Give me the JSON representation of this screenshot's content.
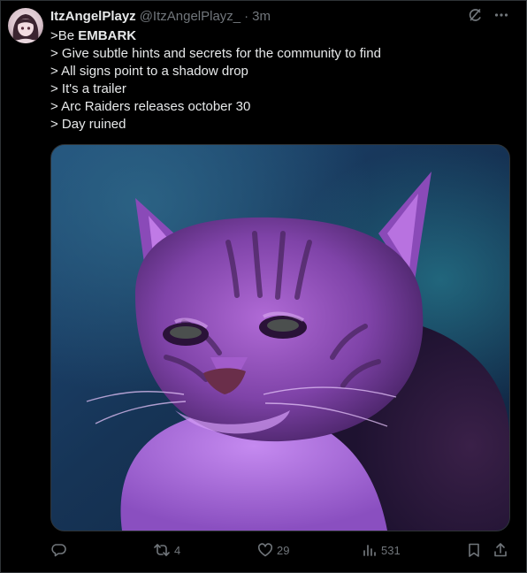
{
  "tweet": {
    "display_name": "ItzAngelPlayz",
    "handle": "@ItzAngelPlayz_",
    "separator": "·",
    "timestamp": "3m",
    "lines": [
      {
        "prefix": ">Be ",
        "bold": "EMBARK"
      },
      {
        "prefix": "> Give subtle hints and secrets for the community to find"
      },
      {
        "prefix": "> All signs point to a shadow drop"
      },
      {
        "prefix": "> It's a trailer"
      },
      {
        "prefix": "> Arc Raiders releases october 30"
      },
      {
        "prefix": "> Day ruined"
      }
    ]
  },
  "top_icons": [
    "grok-icon",
    "more-icon"
  ],
  "media": {
    "subject": "purple-lit tabby cat photo"
  },
  "actions": {
    "reply_count": "",
    "retweet_count": "4",
    "like_count": "29",
    "view_count": "531"
  },
  "colors": {
    "background": "#000000",
    "text": "#e7e9ea",
    "muted": "#71767b",
    "border": "#2f3336"
  }
}
